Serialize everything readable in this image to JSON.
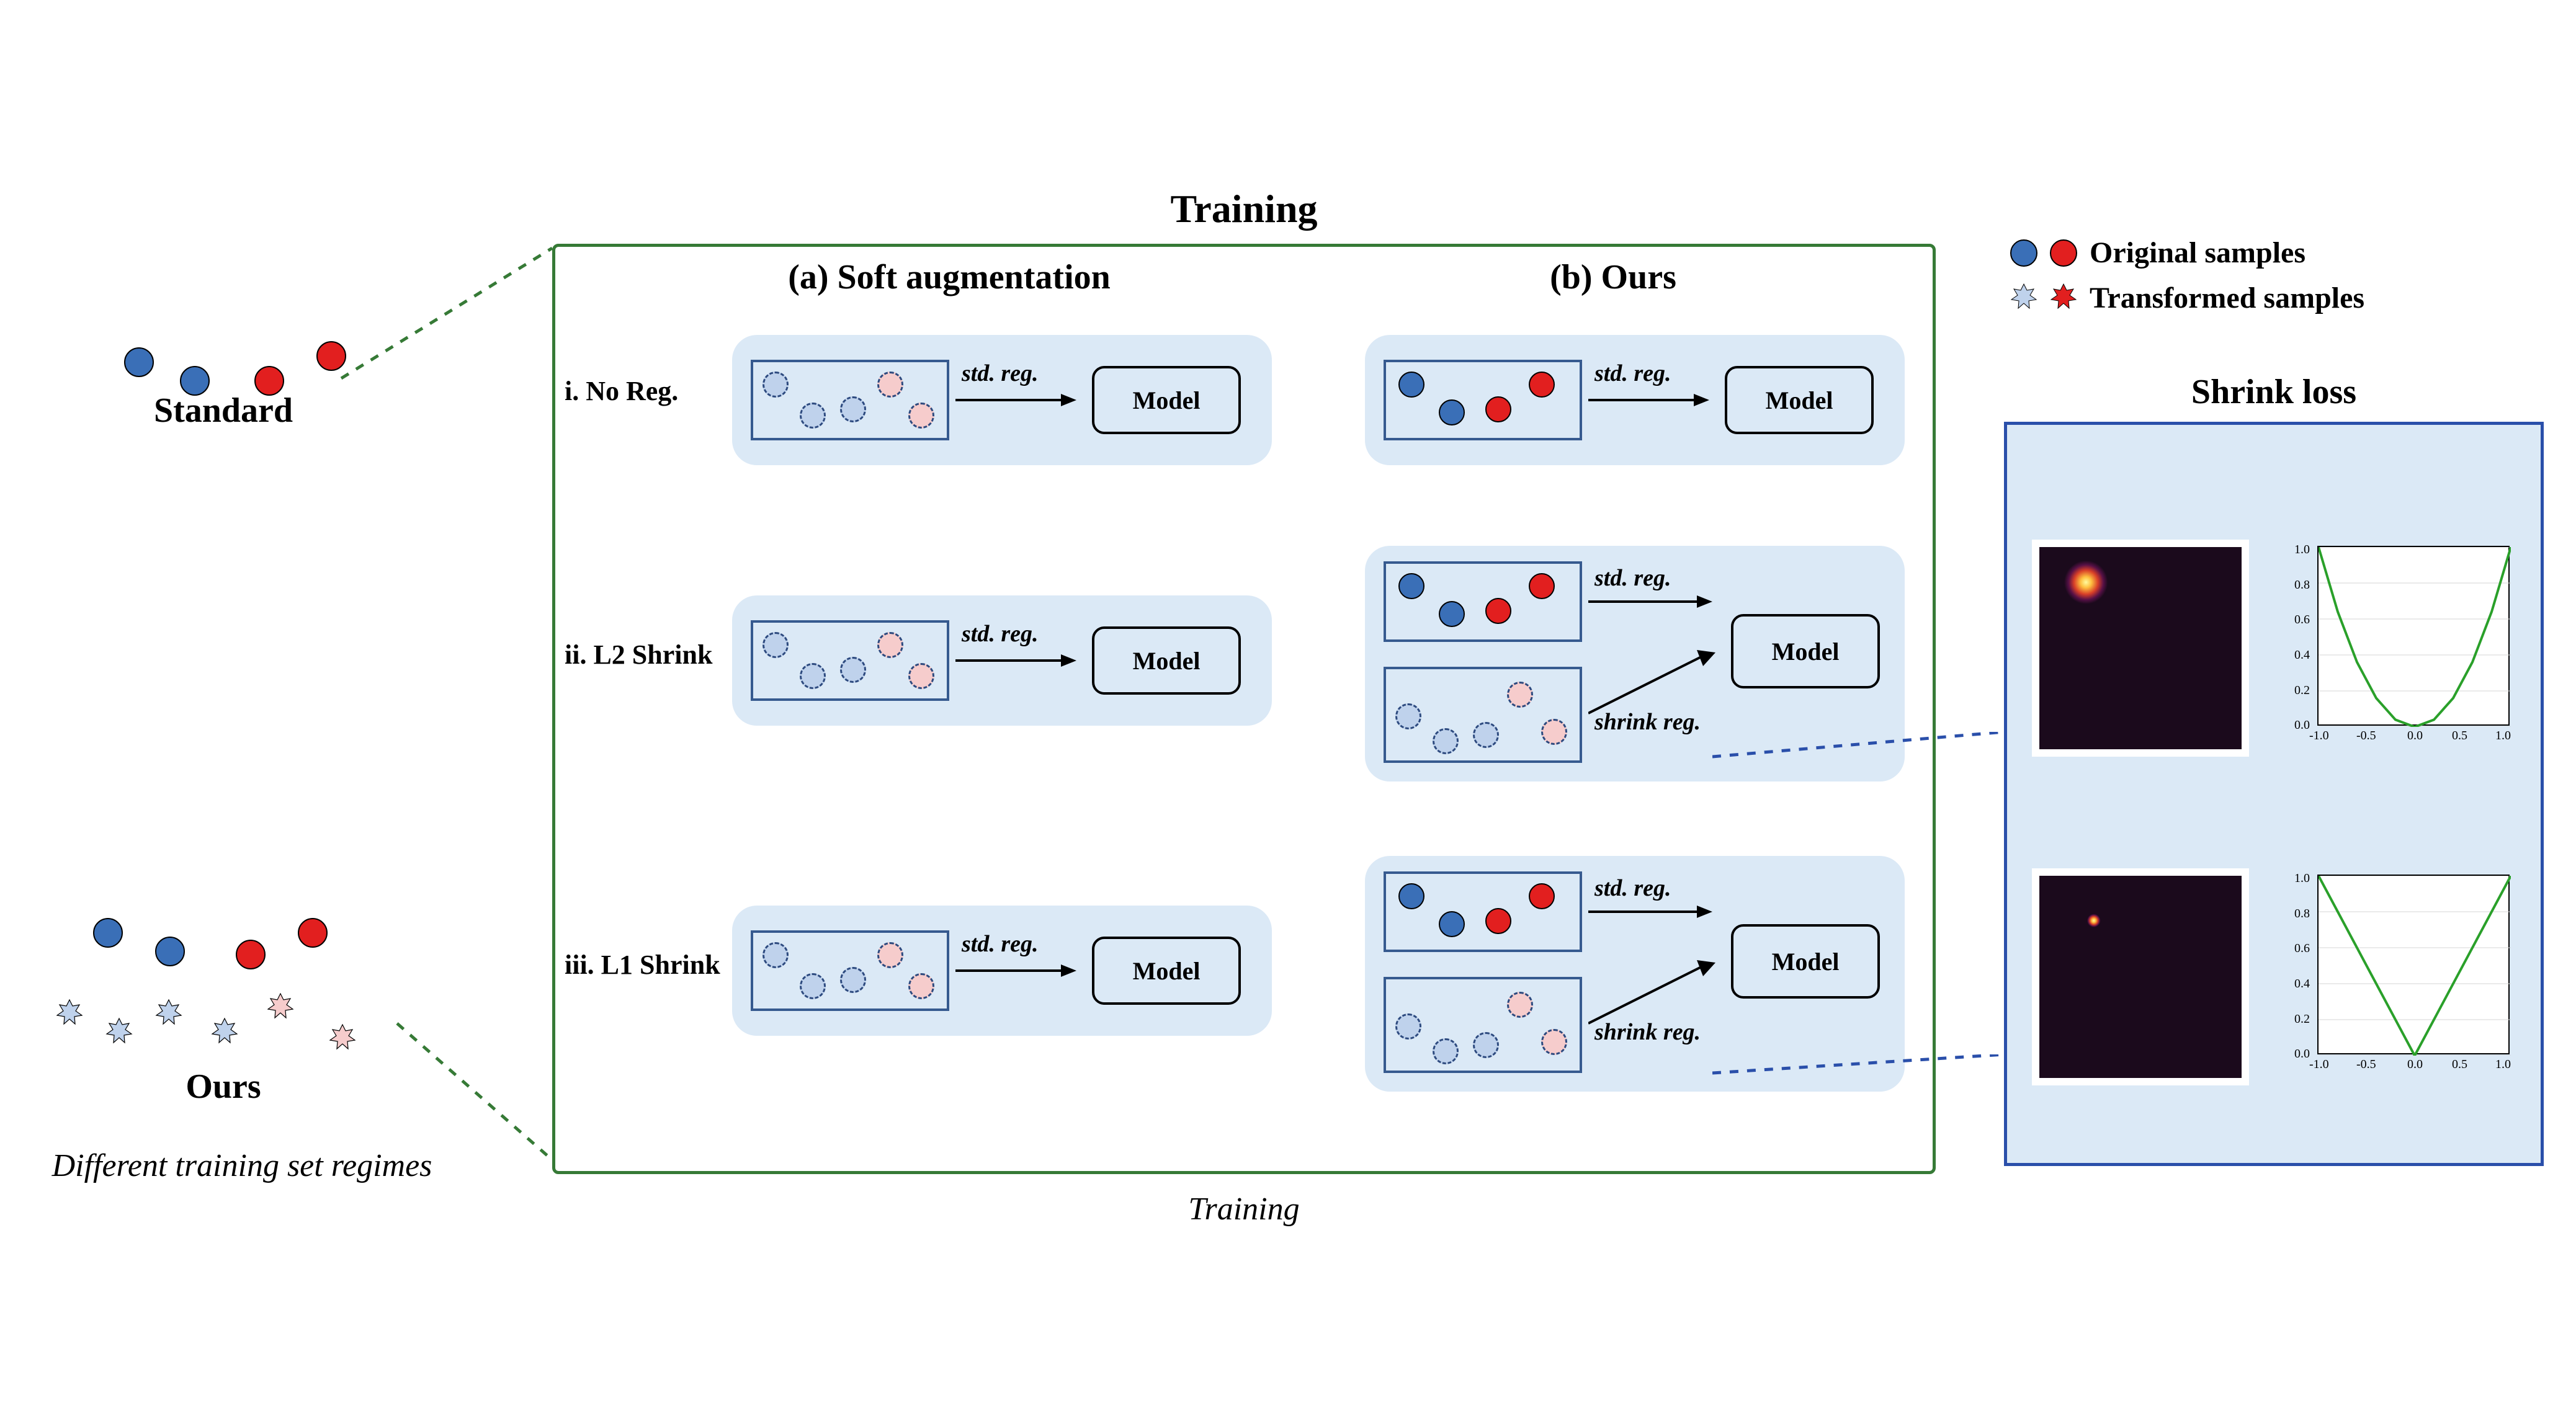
{
  "legend": {
    "original_label": "Original samples",
    "transformed_label": "Transformed samples"
  },
  "left": {
    "standard_label": "Standard",
    "ours_label": "Ours"
  },
  "left_captions": {
    "regimes": "Different training set regimes",
    "training": "Training"
  },
  "green": {
    "title": "Training",
    "col_soft": "(a) Soft augmentation",
    "col_ours": "(b) Ours"
  },
  "rows": {
    "noreg": "i. No Reg.",
    "l2shrink": "ii. L2 Shrink",
    "l1shrink": "iii. L1 Shrink"
  },
  "labels": {
    "std_reg": "std. reg.",
    "shrink_reg": "shrink reg.",
    "model": "Model"
  },
  "blue": {
    "title": "Shrink loss"
  },
  "chart_data": [
    {
      "type": "line",
      "title": "L2 shrink",
      "xlabel": "",
      "ylabel": "",
      "xlim": [
        -1.0,
        1.0
      ],
      "ylim": [
        0.0,
        1.0
      ],
      "xticks": [
        -1.0,
        -0.5,
        0.0,
        0.5,
        1.0
      ],
      "yticks": [
        0.0,
        0.2,
        0.4,
        0.6,
        0.8,
        1.0
      ],
      "series": [
        {
          "name": "loss",
          "x": [
            -1.0,
            -0.8,
            -0.6,
            -0.4,
            -0.2,
            0.0,
            0.2,
            0.4,
            0.6,
            0.8,
            1.0
          ],
          "y": [
            1.0,
            0.64,
            0.36,
            0.16,
            0.04,
            0.0,
            0.04,
            0.16,
            0.36,
            0.64,
            1.0
          ]
        }
      ],
      "color": "#2aa02a"
    },
    {
      "type": "line",
      "title": "L1 shrink",
      "xlabel": "",
      "ylabel": "",
      "xlim": [
        -1.0,
        1.0
      ],
      "ylim": [
        0.0,
        1.0
      ],
      "xticks": [
        -1.0,
        -0.5,
        0.0,
        0.5,
        1.0
      ],
      "yticks": [
        0.0,
        0.2,
        0.4,
        0.6,
        0.8,
        1.0
      ],
      "series": [
        {
          "name": "loss",
          "x": [
            -1.0,
            0.0,
            1.0
          ],
          "y": [
            1.0,
            0.0,
            1.0
          ]
        }
      ],
      "color": "#2aa02a"
    }
  ],
  "colors": {
    "blue": "#3a6fb7",
    "red": "#e21f1f",
    "light_blue": "#bfd2ec",
    "light_red": "#f6cccc",
    "green_box": "#367a36",
    "card_bg": "#dbe9f6",
    "blue_box": "#2a4faa"
  }
}
